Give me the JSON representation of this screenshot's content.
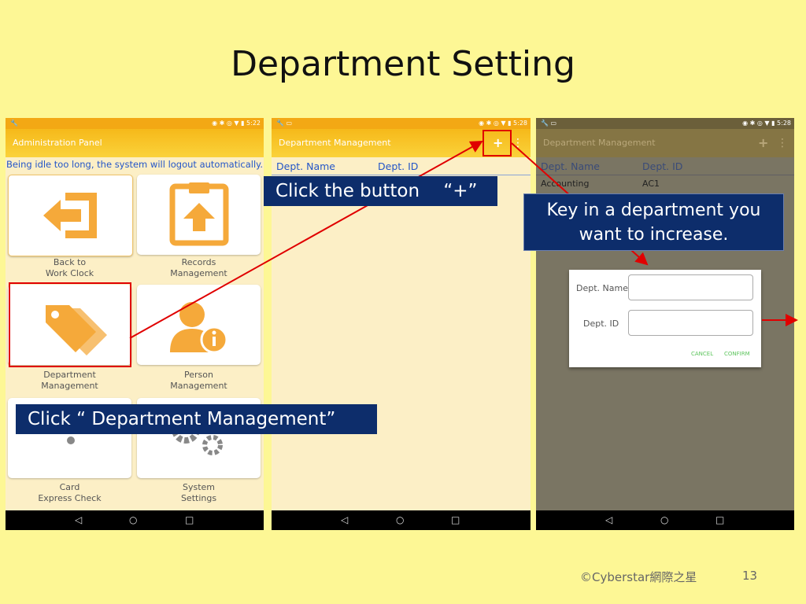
{
  "slide": {
    "title": "Department Setting",
    "footer": "©Cyberstar網際之星",
    "page_number": "13"
  },
  "status": {
    "time_a": "5:22",
    "time_b": "5:28",
    "time_c": "5:28"
  },
  "panel1": {
    "app_title": "Administration Panel",
    "notice": "Being idle too long, the system will logout automatically.",
    "tiles": [
      {
        "line1": "Back to",
        "line2": "Work Clock",
        "icon": "exit-door-icon"
      },
      {
        "line1": "Records",
        "line2": "Management",
        "icon": "clipboard-upload-icon"
      },
      {
        "line1": "Department",
        "line2": "Management",
        "icon": "tags-icon"
      },
      {
        "line1": "Person",
        "line2": "Management",
        "icon": "person-info-icon"
      },
      {
        "line1": "Card",
        "line2": "Express Check",
        "icon": "wifi-icon"
      },
      {
        "line1": "System",
        "line2": "Settings",
        "icon": "gears-icon"
      }
    ]
  },
  "panel2": {
    "app_title": "Department Management",
    "add_glyph": "+",
    "more_glyph": "⋮",
    "col_name": "Dept. Name",
    "col_id": "Dept. ID"
  },
  "panel3": {
    "app_title": "Department Management",
    "add_glyph": "+",
    "more_glyph": "⋮",
    "col_name": "Dept. Name",
    "col_id": "Dept. ID",
    "row": {
      "name": "Accounting",
      "id": "AC1"
    },
    "dialog": {
      "name_label": "Dept. Name",
      "id_label": "Dept. ID",
      "cancel": "CANCEL",
      "confirm": "CONFIRM"
    }
  },
  "callouts": {
    "plus": "Click the button 　“+”",
    "dept": "Click “ Department Management”",
    "key_line1": "Key in a department you",
    "key_line2": "want to increase."
  },
  "colors": {
    "highlight": "#e00000",
    "callout_bg": "#0d2d6b",
    "icon_orange": "#f5a93a",
    "link_blue": "#2456c8"
  }
}
